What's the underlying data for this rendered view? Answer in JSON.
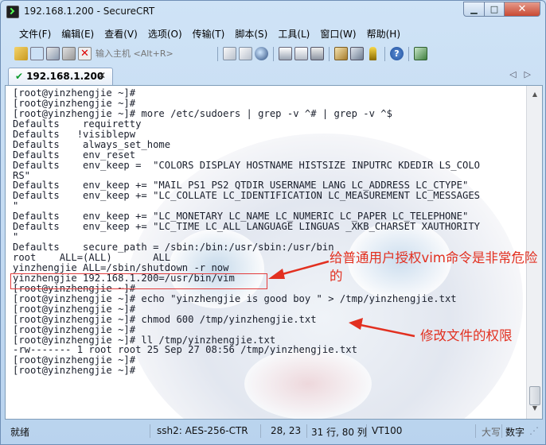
{
  "window": {
    "title": "192.168.1.200 - SecureCRT"
  },
  "menu": [
    {
      "label": "文件(F)"
    },
    {
      "label": "编辑(E)"
    },
    {
      "label": "查看(V)"
    },
    {
      "label": "选项(O)"
    },
    {
      "label": "传输(T)"
    },
    {
      "label": "脚本(S)"
    },
    {
      "label": "工具(L)"
    },
    {
      "label": "窗口(W)"
    },
    {
      "label": "帮助(H)"
    }
  ],
  "toolbar": {
    "host_placeholder": "输入主机 <Alt+R>",
    "left_icons": [
      "connect-icon",
      "quick-connect-icon",
      "connect-tab-icon",
      "reconnect-icon",
      "disconnect-icon"
    ],
    "right_icons": [
      "copy-icon",
      "paste-icon",
      "find-icon",
      "print-icon",
      "print-setup-icon",
      "printer-icon",
      "session-options-icon",
      "global-options-icon",
      "keymap-icon",
      "help-icon",
      "sftp-icon"
    ]
  },
  "tab": {
    "label": "192.168.1.200"
  },
  "terminal": {
    "lines": [
      "[root@yinzhengjie ~]#",
      "[root@yinzhengjie ~]#",
      "[root@yinzhengjie ~]# more /etc/sudoers | grep -v ^# | grep -v ^$",
      "Defaults    requiretty",
      "Defaults   !visiblepw",
      "Defaults    always_set_home",
      "Defaults    env_reset",
      "Defaults    env_keep =  \"COLORS DISPLAY HOSTNAME HISTSIZE INPUTRC KDEDIR LS_COLO",
      "RS\"",
      "Defaults    env_keep += \"MAIL PS1 PS2 QTDIR USERNAME LANG LC_ADDRESS LC_CTYPE\"",
      "Defaults    env_keep += \"LC_COLLATE LC_IDENTIFICATION LC_MEASUREMENT LC_MESSAGES",
      "\"",
      "Defaults    env_keep += \"LC_MONETARY LC_NAME LC_NUMERIC LC_PAPER LC_TELEPHONE\"",
      "Defaults    env_keep += \"LC_TIME LC_ALL LANGUAGE LINGUAS _XKB_CHARSET XAUTHORITY",
      "\"",
      "Defaults    secure_path = /sbin:/bin:/usr/sbin:/usr/bin",
      "root    ALL=(ALL)       ALL",
      "yinzhengjie ALL=/sbin/shutdown -r now",
      "yinzhengjie 192.168.1.200=/usr/bin/vim",
      "[root@yinzhengjie ~]#",
      "[root@yinzhengjie ~]# echo \"yinzhengjie is good boy \" > /tmp/yinzhengjie.txt",
      "[root@yinzhengjie ~]#",
      "[root@yinzhengjie ~]# chmod 600 /tmp/yinzhengjie.txt",
      "[root@yinzhengjie ~]#",
      "[root@yinzhengjie ~]# ll /tmp/yinzhengjie.txt",
      "-rw------- 1 root root 25 Sep 27 08:56 /tmp/yinzhengjie.txt",
      "[root@yinzhengjie ~]#",
      "[root@yinzhengjie ~]#"
    ]
  },
  "annotations": {
    "vim_warning": "给普通用户授权vim命令是非常危险的",
    "permission_note": "修改文件的权限",
    "color": "#e23020"
  },
  "status": {
    "ready": "就绪",
    "cipher": "ssh2: AES-256-CTR",
    "cursor": "28,  23",
    "size": "31 行, 80 列",
    "terminal_type": "VT100",
    "caps": "大写",
    "num": "数字"
  }
}
